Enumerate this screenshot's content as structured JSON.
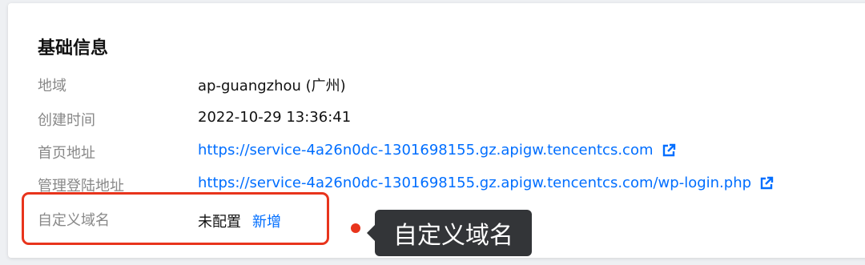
{
  "panel": {
    "title": "基础信息",
    "rows": [
      {
        "label": "地域",
        "value": "ap-guangzhou (广州)"
      },
      {
        "label": "创建时间",
        "value": "2022-10-29 13:36:41"
      },
      {
        "label": "首页地址",
        "value": "https://service-4a26n0dc-1301698155.gz.apigw.tencentcs.com"
      },
      {
        "label": "管理登陆地址",
        "value": "https://service-4a26n0dc-1301698155.gz.apigw.tencentcs.com/wp-login.php"
      },
      {
        "label": "自定义域名",
        "value": "未配置",
        "action": "新增"
      }
    ]
  },
  "annotation": {
    "text": "自定义域名",
    "color": "#e8341c"
  },
  "colors": {
    "link": "#006eff",
    "label": "#888888",
    "tooltip_bg": "#333538"
  },
  "icons": {
    "external_link": "external-link-icon"
  }
}
